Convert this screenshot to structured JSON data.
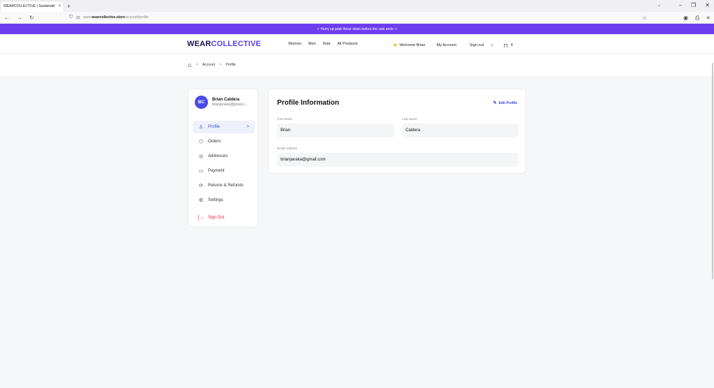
{
  "browser": {
    "tab_title": "WEARCOLLECTIVE | Sustainabl",
    "tab_close": "×",
    "new_tab": "+",
    "url_prefix": "www.",
    "url_domain": "wearcollective.store",
    "url_path": "/account/profile",
    "back": "←",
    "forward": "→",
    "reload": "↻",
    "minimize": "−",
    "restore": "❐",
    "close": "✕",
    "tabs_dropdown": "⌄"
  },
  "promo": {
    "text": "✧ Hurry up grab these deals before the sale ends ✧"
  },
  "header": {
    "logo_part1": "WEAR",
    "logo_part2": "COLLECTIVE",
    "nav": [
      "Women",
      "Men",
      "Kids",
      "All Products"
    ],
    "welcome": "Welcome Brian",
    "my_account": "My Account",
    "sign_out": "Sign out",
    "cart_count": "4"
  },
  "breadcrumb": {
    "items": [
      "Account",
      "Profile"
    ],
    "separator": ">"
  },
  "sidebar": {
    "avatar_initials": "BC",
    "user_name": "Brian Caldera",
    "user_email": "brianjanaka@gmail.c...",
    "items": [
      {
        "label": "Profile",
        "icon": "user-icon",
        "glyph": "♙",
        "active": true
      },
      {
        "label": "Orders",
        "icon": "package-icon",
        "glyph": "⬡"
      },
      {
        "label": "Addresses",
        "icon": "map-pin-icon",
        "glyph": "◎"
      },
      {
        "label": "Payment",
        "icon": "credit-card-icon",
        "glyph": "▭"
      },
      {
        "label": "Returns & Refunds",
        "icon": "refresh-icon",
        "glyph": "⟳"
      },
      {
        "label": "Settings",
        "icon": "gear-icon",
        "glyph": "⚙"
      }
    ],
    "active_chevron": ">",
    "sign_out": {
      "label": "Sign Out",
      "icon": "logout-icon",
      "glyph": "[→"
    }
  },
  "profile": {
    "title": "Profile Information",
    "edit_label": "Edit Profile",
    "first_name_label": "First Name",
    "first_name_value": "Brian",
    "last_name_label": "Last Name",
    "last_name_value": "Caldera",
    "email_label": "Email Address",
    "email_value": "brianjanaka@gmail.com"
  },
  "colors": {
    "promo_bg": "#6e3df0",
    "brand_dark": "#151548",
    "brand_accent": "#5b3bf0",
    "active_blue": "#2f4fd6",
    "danger_red": "#e0263a"
  }
}
